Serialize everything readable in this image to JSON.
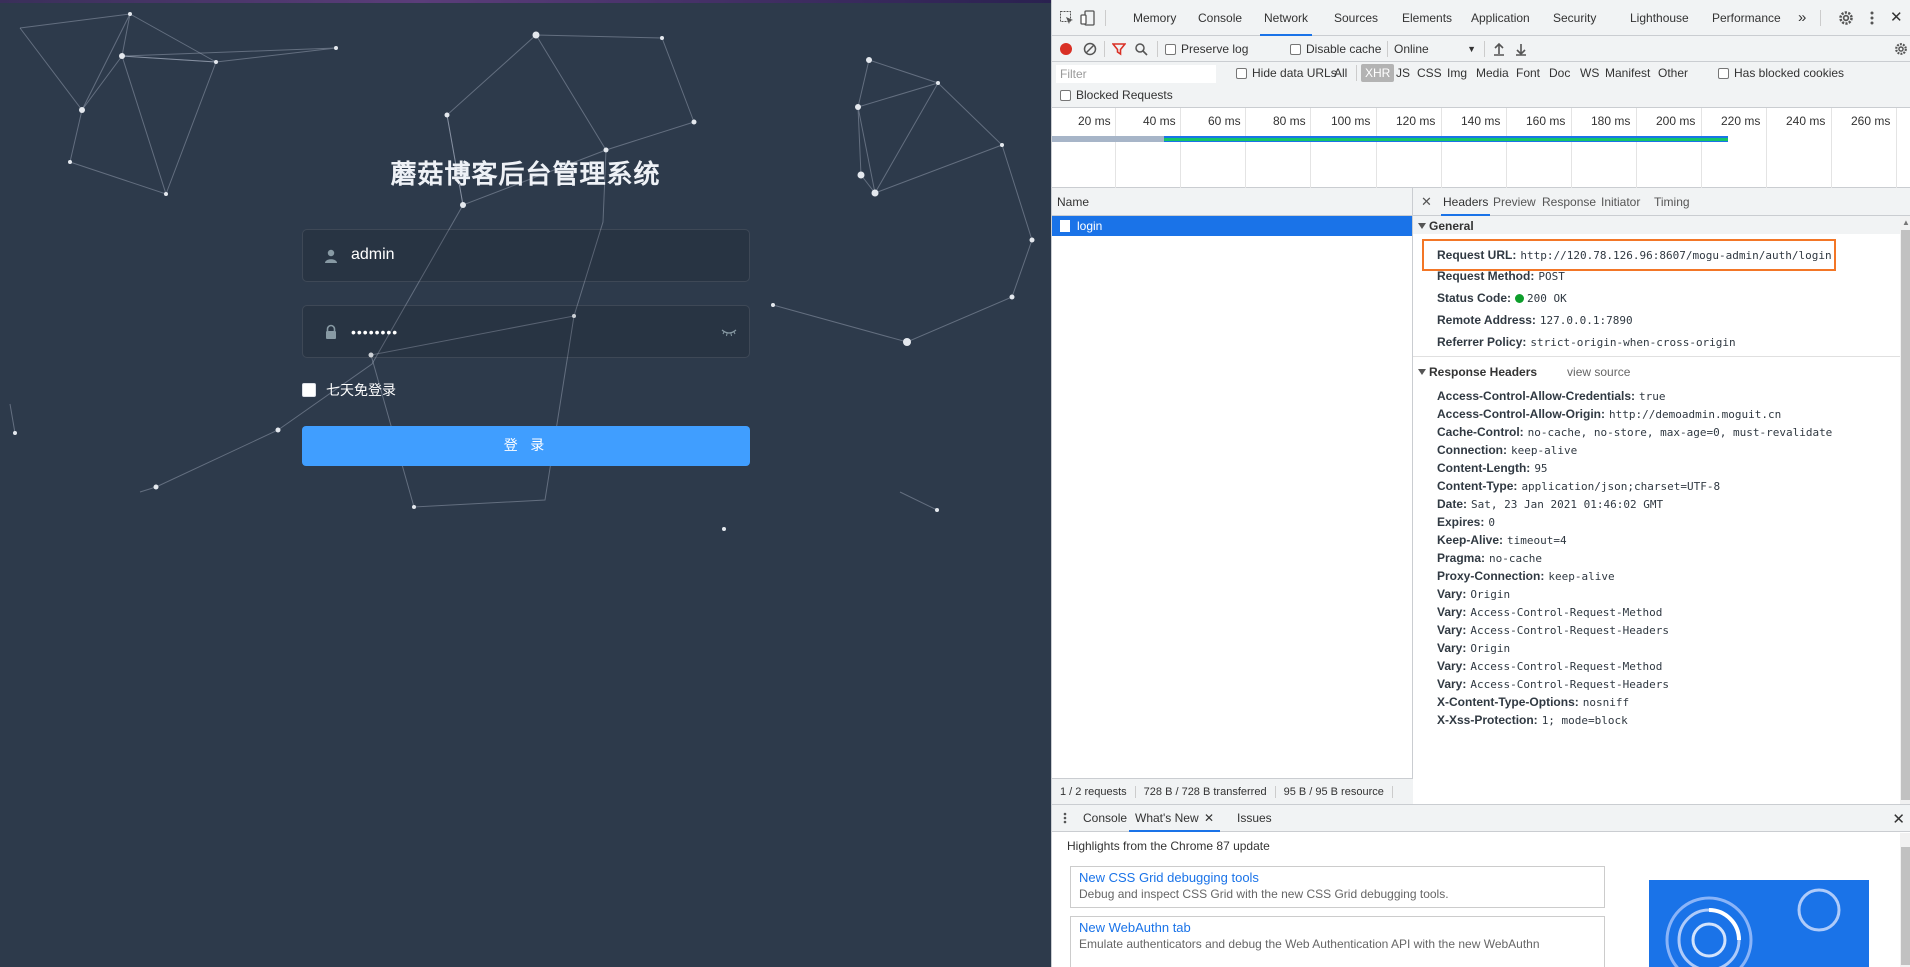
{
  "login": {
    "title": "蘑菇博客后台管理系统",
    "username_value": "admin",
    "password_value": "••••••••",
    "remember_label": "七天免登录",
    "login_button": "登 录"
  },
  "devtools": {
    "tabs": [
      "Memory",
      "Console",
      "Network",
      "Sources",
      "Elements",
      "Application",
      "Security",
      "Lighthouse",
      "Performance"
    ],
    "more_tabs": "»",
    "toolbar": {
      "preserve_log": "Preserve log",
      "disable_cache": "Disable cache",
      "throttle": "Online"
    },
    "filter": {
      "placeholder": "Filter",
      "hide_data_urls": "Hide data URLs",
      "types": [
        "All",
        "XHR",
        "JS",
        "CSS",
        "Img",
        "Media",
        "Font",
        "Doc",
        "WS",
        "Manifest",
        "Other"
      ],
      "active_type": "XHR",
      "has_blocked_cookies": "Has blocked cookies",
      "blocked_requests": "Blocked Requests"
    },
    "timeline_labels": [
      "20 ms",
      "40 ms",
      "60 ms",
      "80 ms",
      "100 ms",
      "120 ms",
      "140 ms",
      "160 ms",
      "180 ms",
      "200 ms",
      "220 ms",
      "240 ms",
      "260 ms"
    ],
    "request_list": {
      "header": "Name",
      "rows": [
        "login"
      ],
      "status": [
        "1 / 2 requests",
        "728 B / 728 B transferred",
        "95 B / 95 B resource"
      ]
    },
    "detail_tabs": [
      "Headers",
      "Preview",
      "Response",
      "Initiator",
      "Timing"
    ],
    "general": {
      "title": "General",
      "request_url_key": "Request URL:",
      "request_url": "http://120.78.126.96:8607/mogu-admin/auth/login",
      "request_method_key": "Request Method:",
      "request_method": "POST",
      "status_code_key": "Status Code:",
      "status_code": "200 OK",
      "remote_address_key": "Remote Address:",
      "remote_address": "127.0.0.1:7890",
      "referrer_policy_key": "Referrer Policy:",
      "referrer_policy": "strict-origin-when-cross-origin"
    },
    "response_headers": {
      "title": "Response Headers",
      "view_source": "view source",
      "items": [
        {
          "k": "Access-Control-Allow-Credentials:",
          "v": "true"
        },
        {
          "k": "Access-Control-Allow-Origin:",
          "v": "http://demoadmin.moguit.cn"
        },
        {
          "k": "Cache-Control:",
          "v": "no-cache, no-store, max-age=0, must-revalidate"
        },
        {
          "k": "Connection:",
          "v": "keep-alive"
        },
        {
          "k": "Content-Length:",
          "v": "95"
        },
        {
          "k": "Content-Type:",
          "v": "application/json;charset=UTF-8"
        },
        {
          "k": "Date:",
          "v": "Sat, 23 Jan 2021 01:46:02 GMT"
        },
        {
          "k": "Expires:",
          "v": "0"
        },
        {
          "k": "Keep-Alive:",
          "v": "timeout=4"
        },
        {
          "k": "Pragma:",
          "v": "no-cache"
        },
        {
          "k": "Proxy-Connection:",
          "v": "keep-alive"
        },
        {
          "k": "Vary:",
          "v": "Origin"
        },
        {
          "k": "Vary:",
          "v": "Access-Control-Request-Method"
        },
        {
          "k": "Vary:",
          "v": "Access-Control-Request-Headers"
        },
        {
          "k": "Vary:",
          "v": "Origin"
        },
        {
          "k": "Vary:",
          "v": "Access-Control-Request-Method"
        },
        {
          "k": "Vary:",
          "v": "Access-Control-Request-Headers"
        },
        {
          "k": "X-Content-Type-Options:",
          "v": "nosniff"
        },
        {
          "k": "X-Xss-Protection:",
          "v": "1; mode=block"
        }
      ]
    },
    "drawer": {
      "tabs": [
        "Console",
        "What's New",
        "Issues"
      ],
      "active_tab": "What's New",
      "heading": "Highlights from the Chrome 87 update",
      "cards": [
        {
          "title": "New CSS Grid debugging tools",
          "desc": "Debug and inspect CSS Grid with the new CSS Grid debugging tools."
        },
        {
          "title": "New WebAuthn tab",
          "desc": "Emulate authenticators and debug the Web Authentication API with the new WebAuthn"
        }
      ]
    },
    "colors": {
      "accent": "#1a73e8",
      "highlight_box": "#f37626",
      "login_bg": "#2d3a4b",
      "login_button": "#409eff"
    }
  }
}
